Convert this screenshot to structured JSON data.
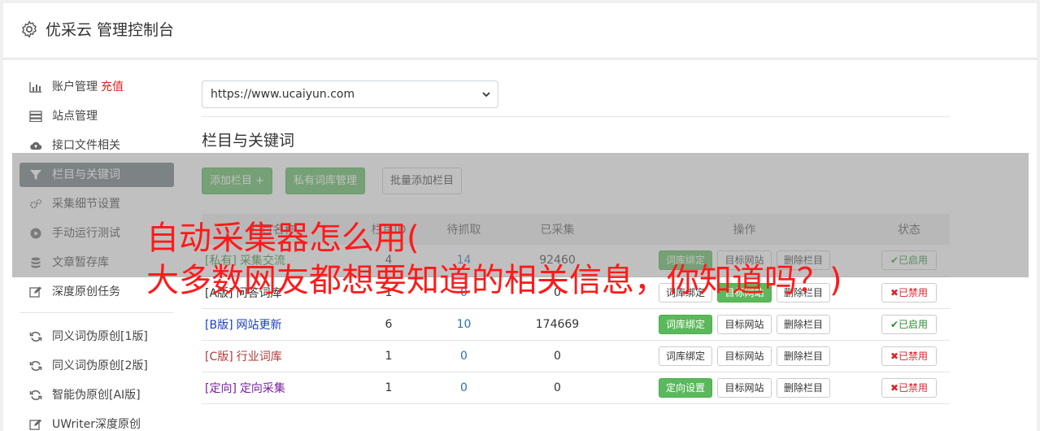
{
  "app": {
    "title": "优采云 管理控制台"
  },
  "sidebar": {
    "items": [
      {
        "label": "账户管理",
        "badge": "充值",
        "icon": "bar-chart-icon"
      },
      {
        "label": "站点管理",
        "icon": "server-icon"
      },
      {
        "label": "接口文件相关",
        "icon": "cloud-upload-icon"
      },
      {
        "label": "栏目与关键词",
        "icon": "filter-icon",
        "active": true
      },
      {
        "label": "采集细节设置",
        "icon": "gears-icon"
      },
      {
        "label": "手动运行测试",
        "icon": "play-circle-icon"
      },
      {
        "label": "文章暂存库",
        "icon": "database-icon"
      },
      {
        "label": "深度原创任务",
        "icon": "edit-icon"
      }
    ],
    "items2": [
      {
        "label": "同义词伪原创[1版]",
        "icon": "refresh-icon"
      },
      {
        "label": "同义词伪原创[2版]",
        "icon": "refresh-icon"
      },
      {
        "label": "智能伪原创[AI版]",
        "icon": "refresh-icon"
      },
      {
        "label": "UWriter深度原创",
        "icon": "edit-icon"
      }
    ]
  },
  "site_select": {
    "value": "https://www.ucaiyun.com"
  },
  "section": {
    "title": "栏目与关键词"
  },
  "toolbar": {
    "add_label": "添加栏目 +",
    "private_label": "私有词库管理",
    "batch_label": "批量添加栏目"
  },
  "table": {
    "headers": [
      "栏目名称",
      "栏目ID",
      "待抓取",
      "已采集",
      "操作",
      "状态"
    ],
    "rows": [
      {
        "tag": "[私有]",
        "name": "采集交流",
        "id": "4",
        "pending": "14",
        "collected": "92460",
        "op1": "词库绑定",
        "op2": "目标网站",
        "op3": "删除栏目",
        "status": "已启用"
      },
      {
        "tag": "[A版]",
        "name": "问答词库",
        "id": "1",
        "pending": "0",
        "collected": "0",
        "op1": "词库绑定",
        "op2": "目标网站",
        "op3": "删除栏目",
        "status": "已禁用"
      },
      {
        "tag": "[B版]",
        "name": "网站更新",
        "id": "6",
        "pending": "10",
        "collected": "174669",
        "op1": "词库绑定",
        "op2": "目标网站",
        "op3": "删除栏目",
        "status": "已启用"
      },
      {
        "tag": "[C版]",
        "name": "行业词库",
        "id": "1",
        "pending": "0",
        "collected": "0",
        "op1": "词库绑定",
        "op2": "目标网站",
        "op3": "删除栏目",
        "status": "已禁用"
      },
      {
        "tag": "[定向]",
        "name": "定向采集",
        "id": "1",
        "pending": "0",
        "collected": "0",
        "op1": "定向设置",
        "op2": "目标网站",
        "op3": "删除栏目",
        "status": "已禁用"
      }
    ]
  },
  "overlay": {
    "line1": "自动采集器怎么用(",
    "line2": "大多数网友都想要知道的相关信息，你知道吗？)"
  },
  "colors": {
    "accent_green": "#5cb85c",
    "active_nav": "#6c757d",
    "overlay_text": "#ff1a1a"
  }
}
